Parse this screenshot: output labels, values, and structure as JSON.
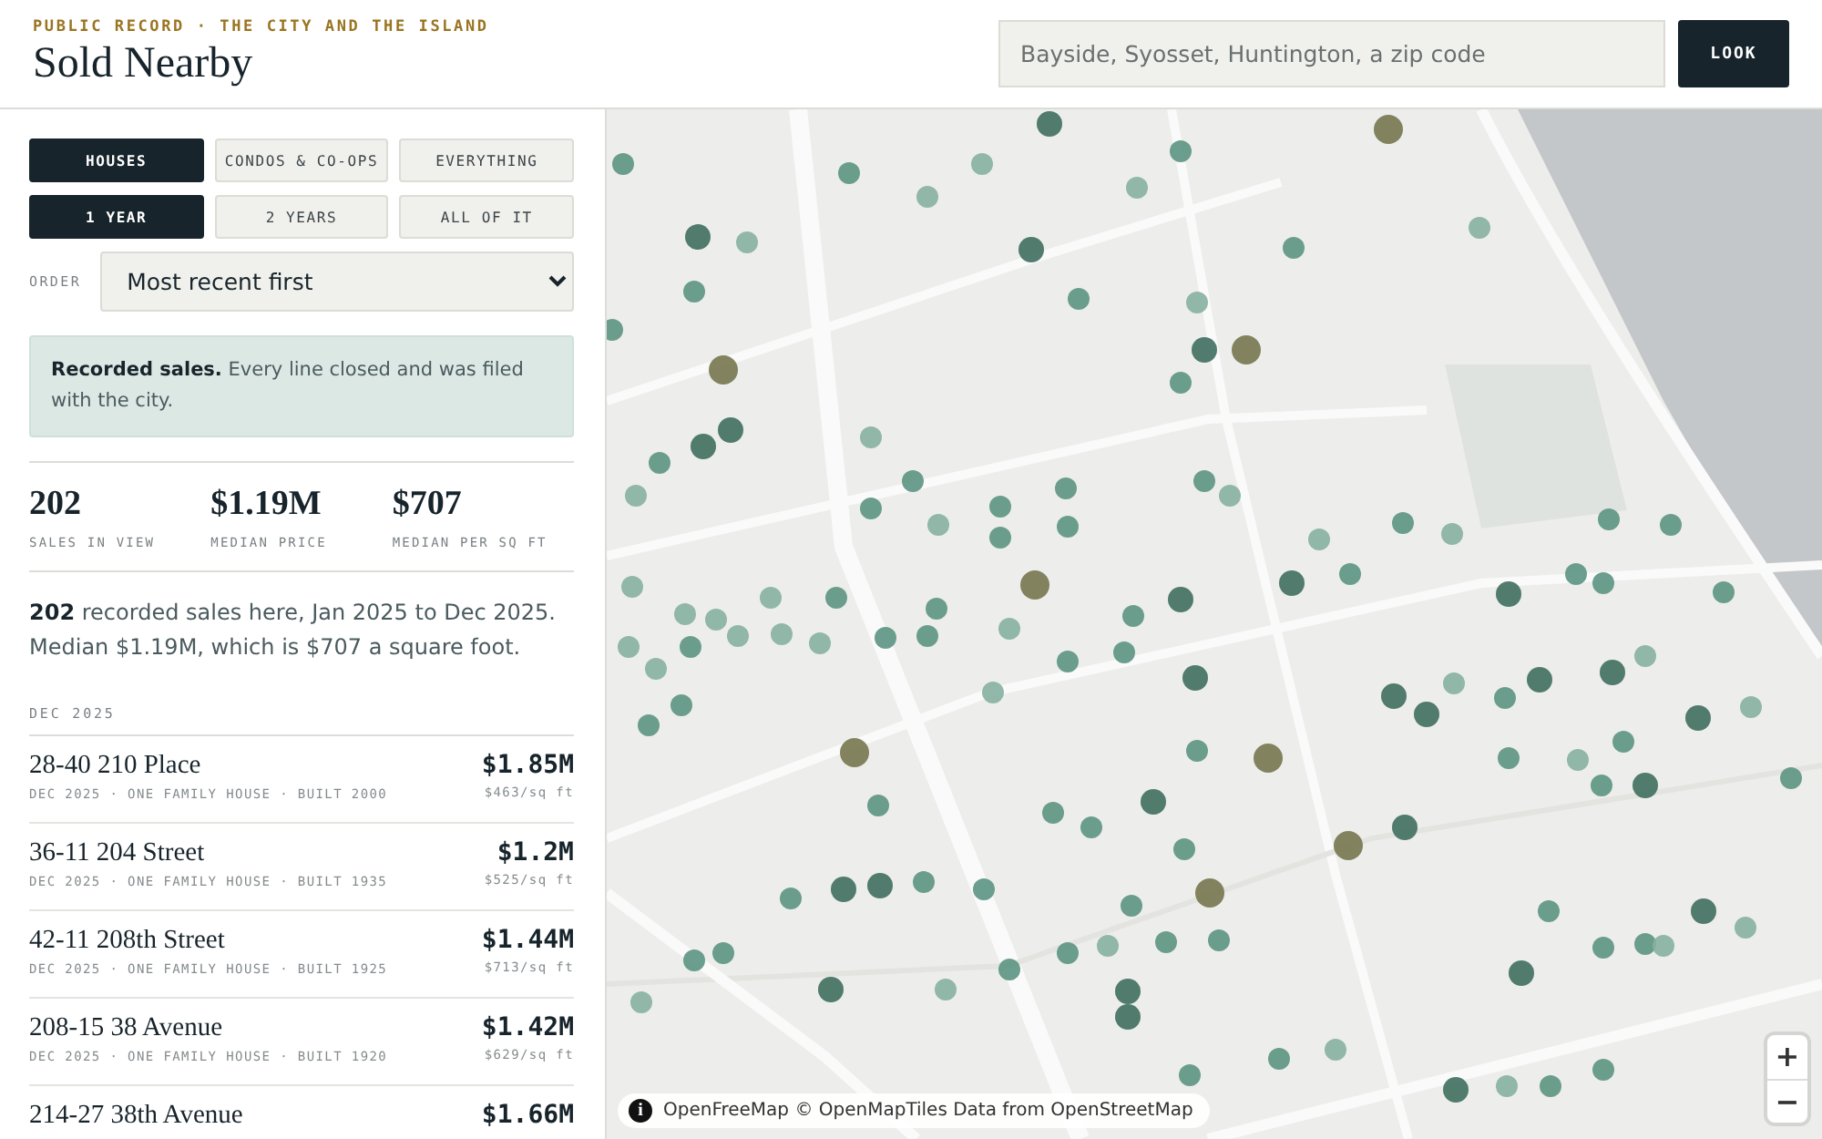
{
  "header": {
    "eyebrow": "PUBLIC RECORD · THE CITY AND THE ISLAND",
    "title": "Sold Nearby"
  },
  "search": {
    "placeholder": "Bayside, Syosset, Huntington, a zip code",
    "button": "LOOK"
  },
  "property_types": [
    {
      "label": "HOUSES",
      "selected": true
    },
    {
      "label": "CONDOS & CO-OPS",
      "selected": false
    },
    {
      "label": "EVERYTHING",
      "selected": false
    }
  ],
  "periods": [
    {
      "label": "1 YEAR",
      "selected": true
    },
    {
      "label": "2 YEARS",
      "selected": false
    },
    {
      "label": "ALL OF IT",
      "selected": false
    }
  ],
  "order": {
    "label": "ORDER",
    "value": "Most recent first"
  },
  "notice": "**Recorded sales.** Every line closed and was filed with the city.",
  "stats": [
    {
      "value": "202",
      "label": "SALES IN VIEW"
    },
    {
      "value": "$1.19M",
      "label": "MEDIAN PRICE"
    },
    {
      "value": "$707",
      "label": "MEDIAN PER SQ FT"
    }
  ],
  "summary": "**202** recorded sales here, Jan 2025 to Dec 2025. Median $1.19M, which is $707 a square foot.",
  "section": "DEC 2025",
  "sales": [
    {
      "address": "28-40 210 Place",
      "details": "DEC 2025 · ONE FAMILY HOUSE · BUILT 2000",
      "price": "$1.85M",
      "per_sqft": "$463/sq ft"
    },
    {
      "address": "36-11 204 Street",
      "details": "DEC 2025 · ONE FAMILY HOUSE · BUILT 1935",
      "price": "$1.2M",
      "per_sqft": "$525/sq ft"
    },
    {
      "address": "42-11 208th Street",
      "details": "DEC 2025 · ONE FAMILY HOUSE · BUILT 1925",
      "price": "$1.44M",
      "per_sqft": "$713/sq ft"
    },
    {
      "address": "208-15 38 Avenue",
      "details": "DEC 2025 · ONE FAMILY HOUSE · BUILT 1920",
      "price": "$1.42M",
      "per_sqft": "$629/sq ft"
    },
    {
      "address": "214-27 38th Avenue",
      "price": "$1.66M"
    }
  ],
  "map": {
    "kind": "picture",
    "zoom_in": "+",
    "zoom_out": "−",
    "info": "i",
    "attribution": "OpenFreeMap © OpenMapTiles Data from OpenStreetMap"
  }
}
